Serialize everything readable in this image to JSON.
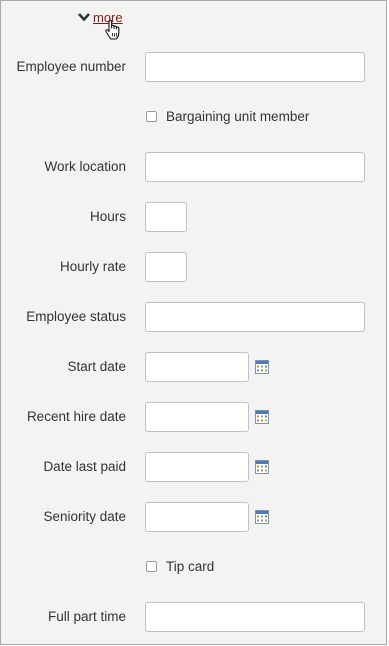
{
  "more_toggle": {
    "label": "more",
    "icon": "chevron-down-icon"
  },
  "fields": {
    "employee_number": {
      "label": "Employee number",
      "value": ""
    },
    "bargaining_unit_member": {
      "label": "Bargaining unit member",
      "checked": false
    },
    "work_location": {
      "label": "Work location",
      "value": ""
    },
    "hours": {
      "label": "Hours",
      "value": ""
    },
    "hourly_rate": {
      "label": "Hourly rate",
      "value": ""
    },
    "employee_status": {
      "label": "Employee status",
      "value": ""
    },
    "start_date": {
      "label": "Start date",
      "value": "",
      "icon": "calendar-icon"
    },
    "recent_hire_date": {
      "label": "Recent hire date",
      "value": "",
      "icon": "calendar-icon"
    },
    "date_last_paid": {
      "label": "Date last paid",
      "value": "",
      "icon": "calendar-icon"
    },
    "seniority_date": {
      "label": "Seniority date",
      "value": "",
      "icon": "calendar-icon"
    },
    "tip_card": {
      "label": "Tip card",
      "checked": false
    },
    "full_part_time": {
      "label": "Full part time",
      "value": ""
    }
  },
  "colors": {
    "panel_background": "#f3f3f3",
    "link": "#8b1414",
    "label_text": "#333333",
    "input_border": "#c2c2c2"
  }
}
